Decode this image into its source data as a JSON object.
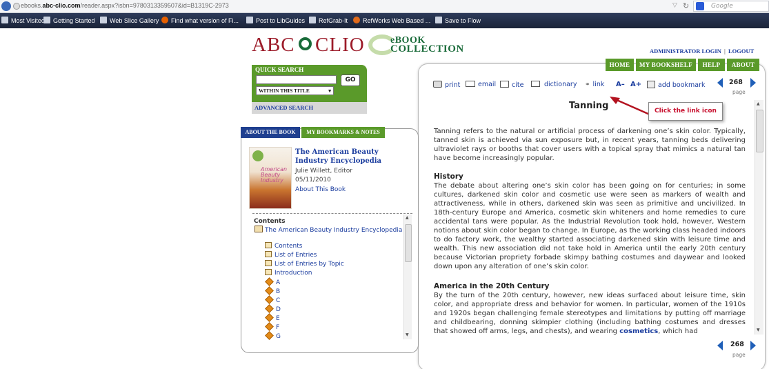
{
  "browser": {
    "url_pre": "ebooks.",
    "url_domain": "abc-clio.com",
    "url_post": "/reader.aspx?isbn=9780313359507&id=B1319C-2973",
    "search_placeholder": "Google",
    "bookmarks": [
      "Most Visited",
      "Getting Started",
      "Web Slice Gallery",
      "Find what version of Fi...",
      "Post to LibGuides",
      "RefGrab-It",
      "RefWorks Web Based ...",
      "Save to Flow"
    ]
  },
  "brand": {
    "abc": "ABC",
    "clio": "CLIO",
    "ebook": "eBOOK",
    "collection": "COLLECTION"
  },
  "header": {
    "admin_login": "ADMINISTRATOR LOGIN",
    "separator": "|",
    "logout": "LOGOUT"
  },
  "nav": {
    "home": "HOME",
    "bookshelf": "MY BOOKSHELF",
    "help": "HELP",
    "about": "ABOUT"
  },
  "quick_search": {
    "title": "QUICK SEARCH",
    "go": "GO",
    "scope": "WITHIN THIS TITLE",
    "advanced": "ADVANCED SEARCH"
  },
  "tabs": {
    "about": "ABOUT THE BOOK",
    "bookmarks": "MY BOOKMARKS & NOTES"
  },
  "book": {
    "title": "The American Beauty Industry Encyclopedia",
    "editor": "Julie Willett, Editor",
    "date": "05/11/2010",
    "about_link": "About This Book",
    "cover_text": "American Beauty Industry"
  },
  "toc": {
    "label": "Contents",
    "root": "The American Beauty Industry Encyclopedia",
    "sections": [
      "Contents",
      "List of Entries",
      "List of Entries by Topic",
      "Introduction"
    ],
    "letters": [
      "A",
      "B",
      "C",
      "D",
      "E",
      "F",
      "G"
    ]
  },
  "toolbar": {
    "print": "print",
    "email": "email",
    "cite": "cite",
    "dictionary": "dictionary",
    "link": "link",
    "font_smaller": "A–",
    "font_larger": "A+",
    "add_bookmark": "add bookmark",
    "page_number": "268",
    "page_label": "page"
  },
  "callout": {
    "text": "Click the link icon",
    "color": "#c8102e"
  },
  "article": {
    "title": "Tanning",
    "intro": "Tanning refers to the natural or artificial process of darkening one’s skin color. Typically, tanned skin is achieved via sun exposure but, in recent years, tanning beds delivering ultraviolet rays or booths that cover users with a topical spray that mimics a natural tan have become increasingly popular.",
    "history_heading": "History",
    "history": "The debate about altering one’s skin color has been going on for centuries; in some cultures, darkened skin color and cosmetic use were seen as markers of wealth and attractiveness, while in others, darkened skin was seen as primitive and uncivilized. In 18th-century Europe and America, cosmetic skin whiteners and home remedies to cure accidental tans were popular. As the Industrial Revolution took hold, however, Western notions about skin color began to change. In Europe, as the working class headed indoors to do factory work, the wealthy started associating darkened skin with leisure time and wealth. This new association did not take hold in America until the early 20th century because Victorian propriety forbade skimpy bathing costumes and daywear and looked down upon any alteration of one’s skin color.",
    "america_heading": "America in the 20th Century",
    "america_pre": "By the turn of the 20th century, however, new ideas surfaced about leisure time, skin color, and appropriate dress and behavior for women. In particular, women of the 1910s and 1920s began challenging female stereotypes and limitations by putting off marriage and childbearing, donning skimpier clothing (including bathing costumes and dresses that showed off arms, legs, and chests), and wearing",
    "america_link": "cosmetics",
    "america_post": ", which had"
  },
  "colors": {
    "accent_green": "#5a9a2a",
    "nav_blue": "#1a3c9e",
    "tab_blue": "#1f3f8f"
  }
}
